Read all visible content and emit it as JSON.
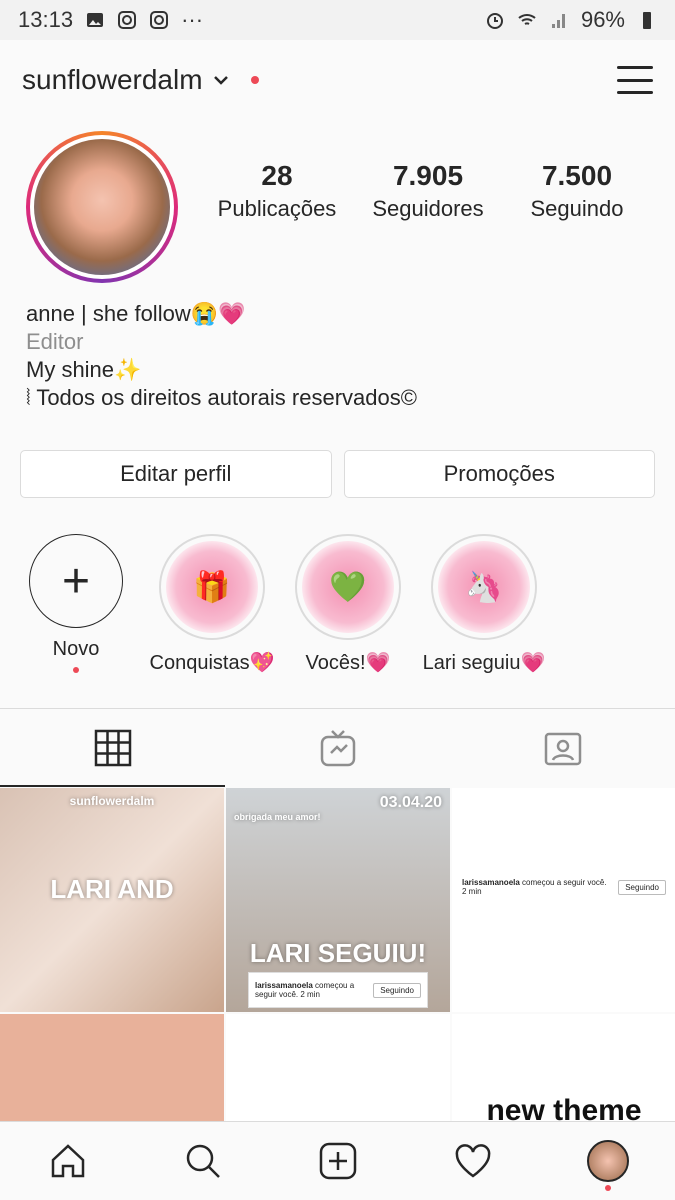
{
  "status": {
    "time": "13:13",
    "battery": "96%"
  },
  "header": {
    "username": "sunflowerdalm"
  },
  "stats": [
    {
      "num": "28",
      "label": "Publicações"
    },
    {
      "num": "7.905",
      "label": "Seguidores"
    },
    {
      "num": "7.500",
      "label": "Seguindo"
    }
  ],
  "bio": {
    "name": "anne | she follow😭💗",
    "category": "Editor",
    "line1": "My shine✨",
    "line2": "⦚ Todos os direitos autorais reservados©"
  },
  "buttons": {
    "edit": "Editar perfil",
    "promo": "Promoções"
  },
  "highlights": [
    {
      "label": "Novo"
    },
    {
      "label": "Conquistas💖"
    },
    {
      "label": "Vocês!💗"
    },
    {
      "label": "Lari seguiu💗"
    }
  ],
  "grid": {
    "post1_title": "sunflowerdalm",
    "post1_text": "LARI AND",
    "post2_date": "03.04.20",
    "post2_text": "LARI SEGUIU!",
    "post2_sub": "obrigada meu amor!",
    "notif_user": "larissamanoela",
    "notif_text": "começou a seguir você.",
    "notif_time": "2 min",
    "notif_btn": "Seguindo",
    "post6_text": "new theme"
  }
}
